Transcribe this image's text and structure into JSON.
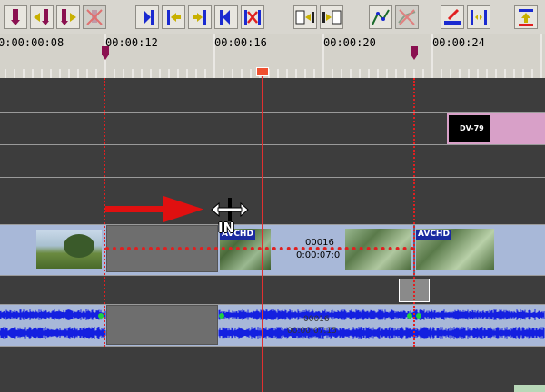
{
  "toolbar": {
    "buttons": [
      {
        "name": "mark-in-button",
        "icon": "mark-in-icon"
      },
      {
        "name": "mark-in-left-button",
        "icon": "mark-left-icon"
      },
      {
        "name": "mark-in-right-button",
        "icon": "mark-right-icon"
      },
      {
        "name": "clear-marks-button",
        "icon": "clear-mark-icon"
      },
      {
        "name": "go-start-button",
        "icon": "go-start-icon"
      },
      {
        "name": "go-prev-button",
        "icon": "go-prev-icon"
      },
      {
        "name": "go-next-button",
        "icon": "go-next-icon"
      },
      {
        "name": "go-end-button",
        "icon": "go-end-icon"
      },
      {
        "name": "delete-range-button",
        "icon": "delete-range-icon"
      },
      {
        "name": "clip-insert-button",
        "icon": "clip-insert-icon"
      },
      {
        "name": "clip-overwrite-button",
        "icon": "clip-overwrite-icon"
      },
      {
        "name": "rubber-band-button",
        "icon": "rubber-band-icon"
      },
      {
        "name": "rubber-band-off-button",
        "icon": "rubber-band-off-icon"
      },
      {
        "name": "edit-button",
        "icon": "edit-icon"
      },
      {
        "name": "split-button",
        "icon": "split-icon"
      },
      {
        "name": "export-button",
        "icon": "export-icon"
      }
    ]
  },
  "ruler": {
    "timecodes": [
      "0:00:00:08",
      "00:00:12",
      "00:00:16",
      "00:00:20",
      "00:00:24"
    ]
  },
  "clips": {
    "title_clip_label": "DV-79",
    "avchd_label_1": "AVCHD",
    "avchd_label_2": "AVCHD",
    "video_mid_label": "00016",
    "video_mid_tc": "0:00:07:0",
    "audio_mid_label": "00016",
    "audio_mid_tc": "00:00:07:15"
  },
  "cursor": {
    "label": "IN"
  },
  "colors": {
    "timeline_bg": "#3d3d3d",
    "clip_bg": "#a8b8d8",
    "selection_gray": "#6e6e6e",
    "title_clip_pink": "#d8a0c8",
    "playhead": "#e02020",
    "waveform": "#1420e0",
    "label_blue": "#1a2aa0"
  }
}
